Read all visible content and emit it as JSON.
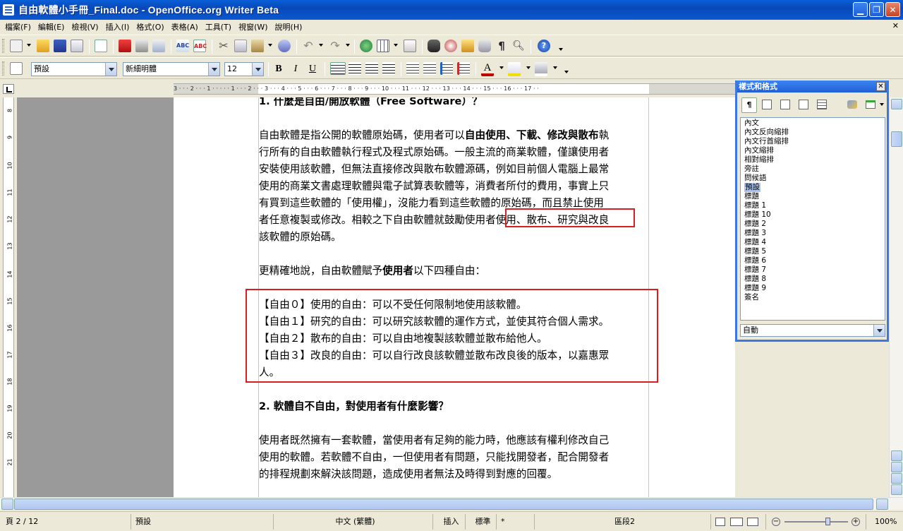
{
  "window": {
    "title": "自由軟體小手冊_Final.doc - OpenOffice.org Writer Beta",
    "minimize": "▁",
    "maximize": "❐",
    "close": "✕"
  },
  "menu": [
    {
      "label": "檔案(F)"
    },
    {
      "label": "編輯(E)"
    },
    {
      "label": "檢視(V)"
    },
    {
      "label": "插入(I)"
    },
    {
      "label": "格式(O)"
    },
    {
      "label": "表格(A)"
    },
    {
      "label": "工具(T)"
    },
    {
      "label": "視窗(W)"
    },
    {
      "label": "說明(H)"
    }
  ],
  "menu_close": "✕",
  "format_toolbar": {
    "paragraph_style": "預設",
    "font_name": "新細明體",
    "font_size": "12",
    "bold": "B",
    "italic": "I",
    "underline": "U"
  },
  "ruler_ticks": "3 · · · 2 · · · 1 · · · · · 1 · · · 2 · · · 3 · · · 4 · · · 5 · · · 6 · · · 7 · · · 8 · · · 9 · · · 10 · · · 11 · · · 12 · · · 13 · · · 14 · · · 15 · · · 16 · · · 17 · ·",
  "vruler_numbers": [
    "8",
    "9",
    "10",
    "11",
    "12",
    "13",
    "14",
    "15",
    "16",
    "17",
    "18",
    "19",
    "20",
    "21"
  ],
  "document": {
    "heading1": "1. 什麼是自由/開放軟體（Free Software）？",
    "p1": {
      "l1_a": "自由軟體是指公開的軟體原始碼，使用者可以",
      "l1_b": "自由使用、下載、修改與散布",
      "l1_c": "執",
      "l2": "行所有的自由軟體執行程式及程式原始碼。一般主流的商業軟體，僅讓使用者",
      "l3": "安裝使用該軟體，但無法直接修改與散布軟體源碼，例如目前個人電腦上最常",
      "l4": "使用的商業文書處理軟體與電子試算表軟體等，消費者所付的費用，事實上只",
      "l5": "有買到這些軟體的「使用權」，沒能力看到這些軟體的原始碼，而且禁止使用",
      "l6": "者任意複製或修改。相較之下自由軟體就鼓勵使用者使用、散布、研究與改良",
      "l7": "該軟體的原始碼。"
    },
    "p2": {
      "a": "更精確地說，自由軟體賦予",
      "b": "使用者",
      "c": "以下四種自由："
    },
    "freedoms": [
      "【自由０】使用的自由：可以不受任何限制地使用該軟體。",
      "【自由１】研究的自由：可以研究該軟體的運作方式，並使其符合個人需求。",
      "【自由２】散布的自由：可以自由地複製該軟體並散布給他人。",
      "【自由３】改良的自由：可以自行改良該軟體並散布改良後的版本，以嘉惠眾",
      "人。"
    ],
    "heading2": "2. 軟體自不自由，對使用者有什麼影響？",
    "p3": {
      "l1": "使用者既然擁有一套軟體，當使用者有足夠的能力時，他應該有權利修改自己",
      "l2": "使用的軟體。若軟體不自由，一但使用者有問題，只能找開發者，配合開發者",
      "l3": "的排程規劃來解決該問題，造成使用者無法及時得到對應的回覆。"
    }
  },
  "styles_panel": {
    "title": "樣式和格式",
    "close": "✕",
    "items": [
      {
        "label": "內文"
      },
      {
        "label": "內文反向縮排"
      },
      {
        "label": "內文行首縮排"
      },
      {
        "label": "內文縮排"
      },
      {
        "label": "相對縮排"
      },
      {
        "label": "旁註"
      },
      {
        "label": "問候語"
      },
      {
        "label": "預設",
        "selected": true
      },
      {
        "label": "標題"
      },
      {
        "label": "標題 1"
      },
      {
        "label": "標題 10"
      },
      {
        "label": "標題 2"
      },
      {
        "label": "標題 3"
      },
      {
        "label": "標題 4"
      },
      {
        "label": "標題 5"
      },
      {
        "label": "標題 6"
      },
      {
        "label": "標題 7"
      },
      {
        "label": "標題 8"
      },
      {
        "label": "標題 9"
      },
      {
        "label": "簽名"
      }
    ],
    "filter": "自動"
  },
  "statusbar": {
    "page": "頁 2 / 12",
    "style": "預設",
    "language": "中文 (繁體)",
    "insert_mode": "插入",
    "selection_mode": "標準",
    "modified": "*",
    "section": "區段2",
    "zoom": "100%",
    "zoom_minus": "−",
    "zoom_plus": "+"
  },
  "colors": {
    "titlebar": "#0a5fd8",
    "highlight_box": "#d81e1e",
    "panel_border": "#3c78e0"
  }
}
